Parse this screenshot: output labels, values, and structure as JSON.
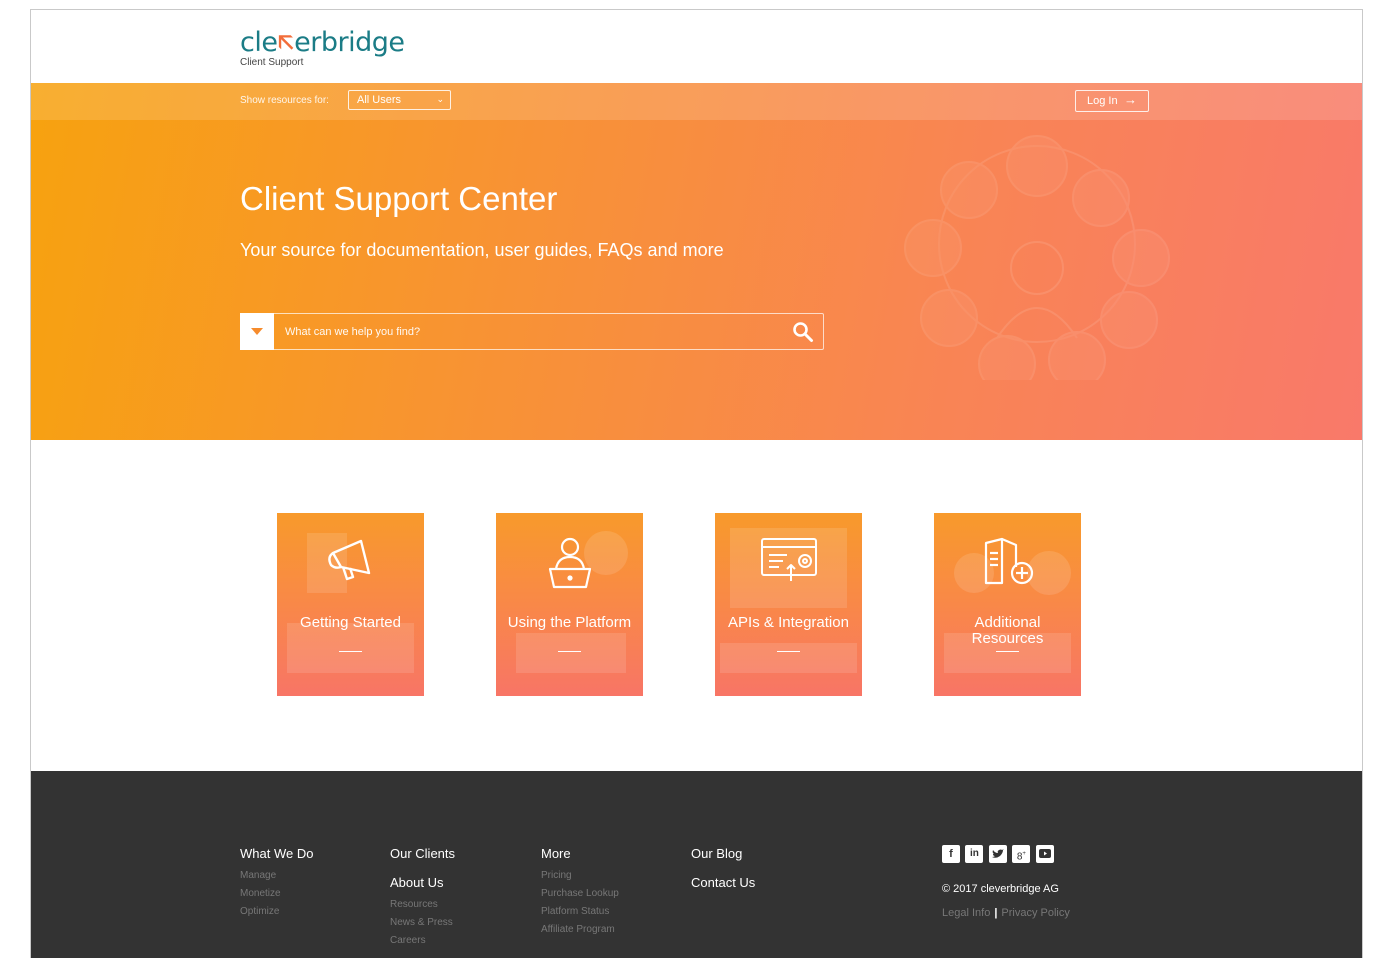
{
  "header": {
    "logo_main": "cleverbridge",
    "logo_sub": "Client Support"
  },
  "resources": {
    "label": "Show resources for:",
    "selected": "All Users",
    "login": "Log In"
  },
  "hero": {
    "title": "Client Support Center",
    "subtitle": "Your source for documentation, user guides, FAQs and more",
    "search_placeholder": "What can we help you find?"
  },
  "cards": [
    {
      "label": "Getting Started",
      "icon": "megaphone-icon"
    },
    {
      "label": "Using the Platform",
      "icon": "user-laptop-icon"
    },
    {
      "label": "APIs & Integration",
      "icon": "api-window-icon"
    },
    {
      "label": "Additional Resources",
      "icon": "document-plus-icon"
    }
  ],
  "footer": {
    "col1": {
      "heading": "What We Do",
      "links": [
        "Manage",
        "Monetize",
        "Optimize"
      ]
    },
    "col2": {
      "heading": "Our Clients",
      "heading2": "About Us",
      "links": [
        "Resources",
        "News & Press",
        "Careers"
      ]
    },
    "col3": {
      "heading": "More",
      "links": [
        "Pricing",
        "Purchase Lookup",
        "Platform Status",
        "Affiliate Program"
      ]
    },
    "col4": {
      "heading": "Our Blog",
      "heading2": "Contact Us"
    },
    "social": [
      "facebook-icon",
      "linkedin-icon",
      "twitter-icon",
      "googleplus-icon",
      "youtube-icon"
    ],
    "copyright": "© 2017 cleverbridge AG",
    "legal_info": "Legal Info",
    "privacy": "Privacy Policy"
  },
  "colors": {
    "brand_teal": "#1b7c86",
    "brand_orange": "#f7a20f",
    "hero_end": "#f9796a",
    "footer_bg": "#333333"
  }
}
